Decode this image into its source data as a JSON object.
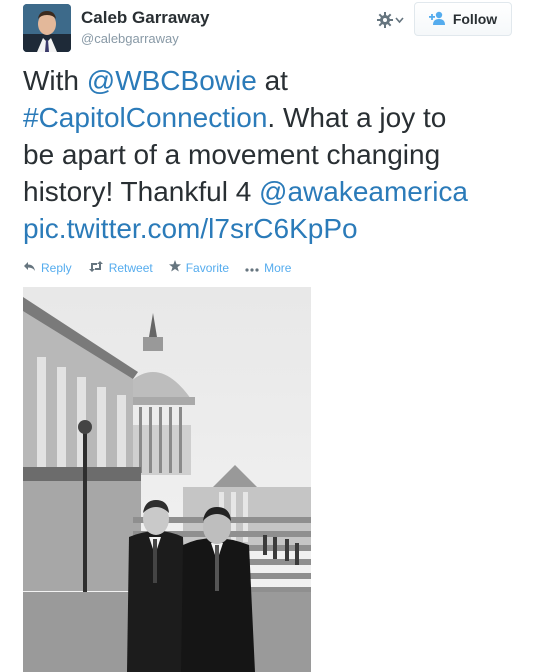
{
  "user": {
    "name": "Caleb Garraway",
    "handle": "@calebgarraway"
  },
  "follow_label": "Follow",
  "tweet": {
    "t1": "With ",
    "m1": "@WBCBowie",
    "t2": " at",
    "h1": "#CapitolConnection",
    "t3": ". What a joy to",
    "t4": "be apart of a movement changing",
    "t5": "history! Thankful 4 ",
    "m2": "@awakeamerica",
    "link": "pic.twitter.com/l7srC6KpPo"
  },
  "actions": {
    "reply": "Reply",
    "retweet": "Retweet",
    "favorite": "Favorite",
    "more": "More"
  },
  "icons": {
    "gear": "gear-icon",
    "follow": "add-user-icon",
    "reply": "reply-icon",
    "retweet": "retweet-icon",
    "favorite": "star-icon",
    "more": "ellipsis-icon"
  },
  "colors": {
    "link": "#2b7bb9",
    "action": "#55acee",
    "text": "#292f33",
    "muted": "#8899a6"
  }
}
